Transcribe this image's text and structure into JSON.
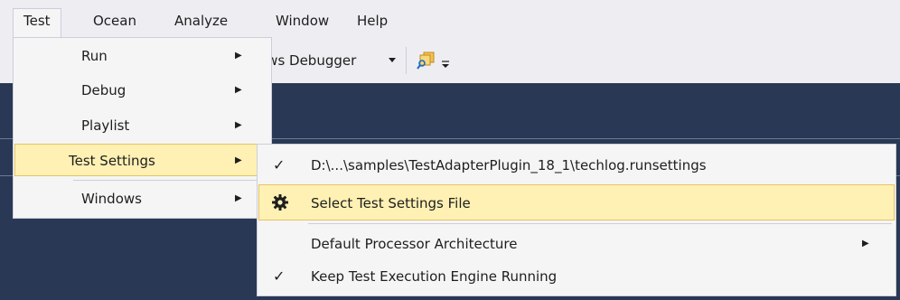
{
  "menubar": {
    "items": [
      "Test",
      "Ocean",
      "Analyze",
      "Window",
      "Help"
    ]
  },
  "toolbar": {
    "debugger_text": "ows Debugger",
    "dropdown_icon": "triangle-down",
    "find_icon": "find-icon",
    "overflow_icon": "toolbar-overflow-icon"
  },
  "test_menu": {
    "items": [
      {
        "label": "Run",
        "has_submenu": true
      },
      {
        "label": "Debug",
        "has_submenu": true
      },
      {
        "label": "Playlist",
        "has_submenu": true
      },
      {
        "label": "Test Settings",
        "has_submenu": true,
        "highlighted": true
      },
      {
        "label": "Windows",
        "has_submenu": true
      }
    ]
  },
  "settings_submenu": {
    "items": [
      {
        "label": "D:\\...\\samples\\TestAdapterPlugin_18_1\\techlog.runsettings",
        "checked": true
      },
      {
        "label": "Select Test Settings File",
        "icon": "gear-icon",
        "highlighted": true
      },
      {
        "label": "Default Processor Architecture",
        "has_submenu": true
      },
      {
        "label": "Keep Test Execution Engine Running",
        "checked": true
      }
    ]
  },
  "colors": {
    "chrome": "#eeeef2",
    "editor_background": "#293955",
    "highlight": "#fff1b3",
    "highlight_border": "#e5c365"
  }
}
